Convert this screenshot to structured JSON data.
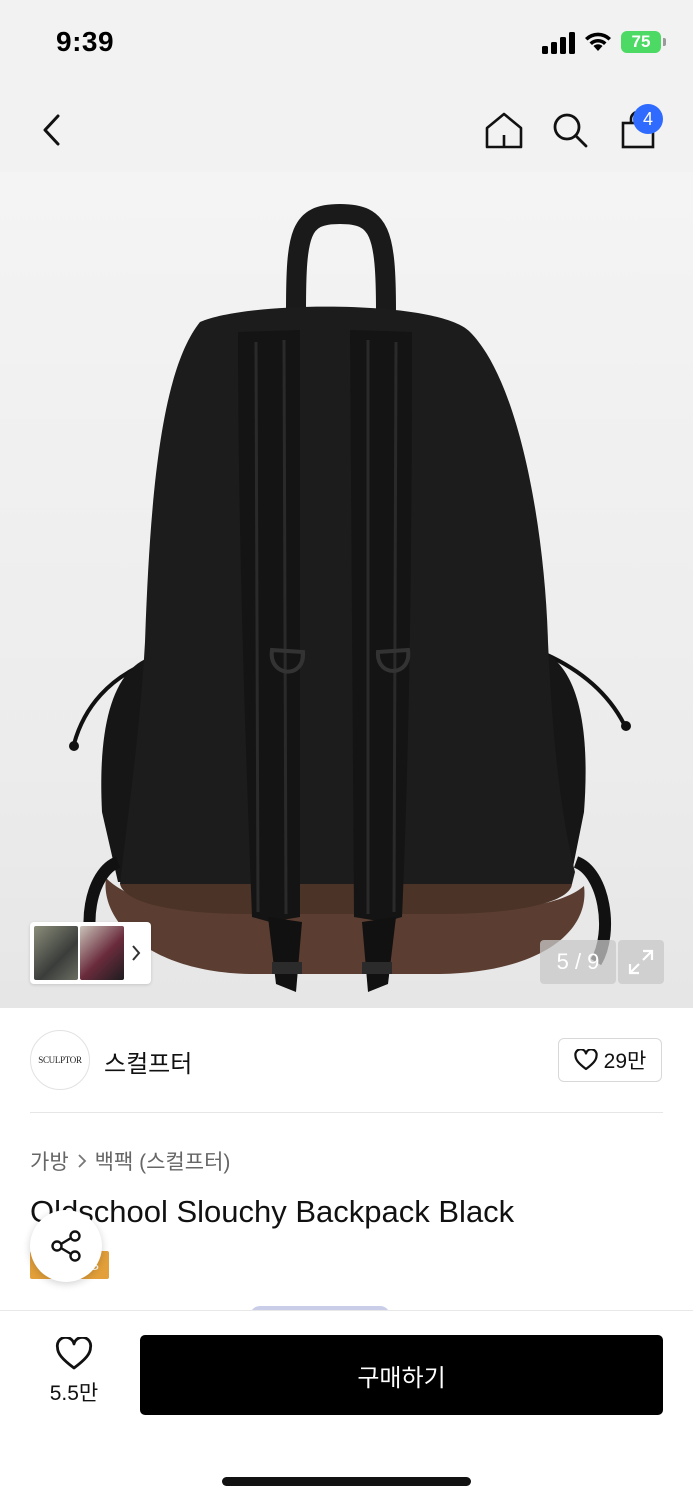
{
  "status_bar": {
    "time": "9:39",
    "battery": "75",
    "icons": [
      "signal-icon",
      "wifi-icon",
      "battery-icon"
    ]
  },
  "header": {
    "icons": [
      "back-icon",
      "home-icon",
      "search-icon",
      "shopping-bag-icon"
    ],
    "cart_count": "4"
  },
  "gallery": {
    "counter": "5 / 9",
    "icons": [
      "chevron-right-icon",
      "expand-icon"
    ]
  },
  "brand": {
    "logo_text": "SCULPTOR",
    "name": "스컬프터",
    "like_count": "29만",
    "icons": [
      "heart-icon"
    ]
  },
  "product": {
    "breadcrumb": [
      "가방",
      "백팩 (스컬프터)"
    ],
    "title": "Oldschool Slouchy Backpack Black",
    "tag": "S",
    "icons": [
      "share-icon"
    ]
  },
  "bottom_bar": {
    "wish_count": "5.5만",
    "buy_label": "구매하기",
    "icons": [
      "heart-icon"
    ]
  },
  "colors": {
    "accent_blue": "#2f6bff",
    "battery_green": "#4cd964",
    "tag_orange": "#e3a03a",
    "buy_button": "#000000"
  }
}
